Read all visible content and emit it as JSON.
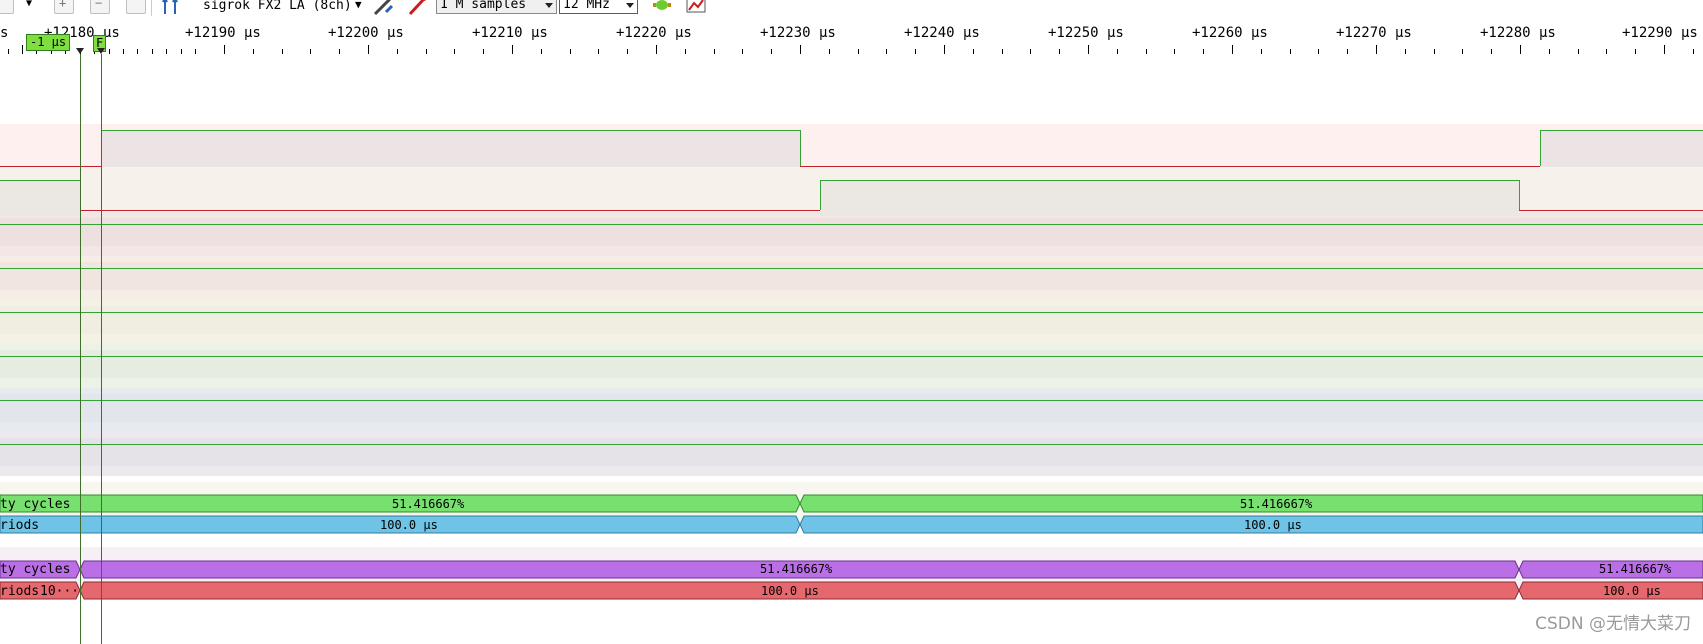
{
  "toolbar": {
    "device": "sigrok FX2 LA (8ch)",
    "samples": "1 M samples",
    "samplerate": "12 MHz"
  },
  "ruler": {
    "left_label": "s",
    "labels": [
      "+12190 μs",
      "+12200 μs",
      "+12210 μs",
      "+12220 μs",
      "+12230 μs",
      "+12240 μs",
      "+12250 μs",
      "+12260 μs",
      "+12270 μs",
      "+12280 μs",
      "+12290 μs"
    ]
  },
  "cursors": {
    "delta_label": "-1 μs",
    "trigger_flag": "F"
  },
  "annotations": {
    "row1": {
      "label": "ty cycles",
      "values": [
        "51.416667%",
        "51.416667%"
      ],
      "color": "#77e06f"
    },
    "row2": {
      "label": "riods",
      "values": [
        "100.0 μs",
        "100.0 μs"
      ],
      "color": "#6fc3e6"
    },
    "row3": {
      "label": "ty cycles",
      "values": [
        "51.416667%",
        "51.416667%"
      ],
      "color": "#bb6fe6"
    },
    "row4": {
      "label": "riods",
      "overflow": "10···",
      "values": [
        "100.0 μs",
        "100.0 μs"
      ],
      "color": "#e6686f"
    }
  },
  "watermark": "CSDN @无情大菜刀"
}
